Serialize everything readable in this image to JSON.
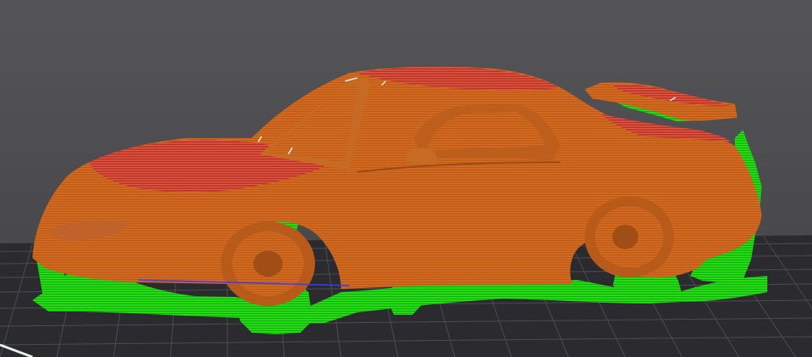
{
  "viewport": {
    "background_color": "#4a4a4e",
    "bed": {
      "grid_color": "#4a4a50",
      "plate_color": "#2a2a2e",
      "edge_highlight": "#e8f0ec"
    },
    "model": {
      "object": "car",
      "view": "3d-preview",
      "colors": {
        "perimeter": "#d2691e",
        "perimeter_shade": "#b85a1a",
        "top_solid": "#c0392b",
        "top_solid_light": "#e15b45",
        "support": "#22dd11",
        "support_dark": "#16a80c",
        "travel_line": "#3a3aff"
      }
    }
  }
}
